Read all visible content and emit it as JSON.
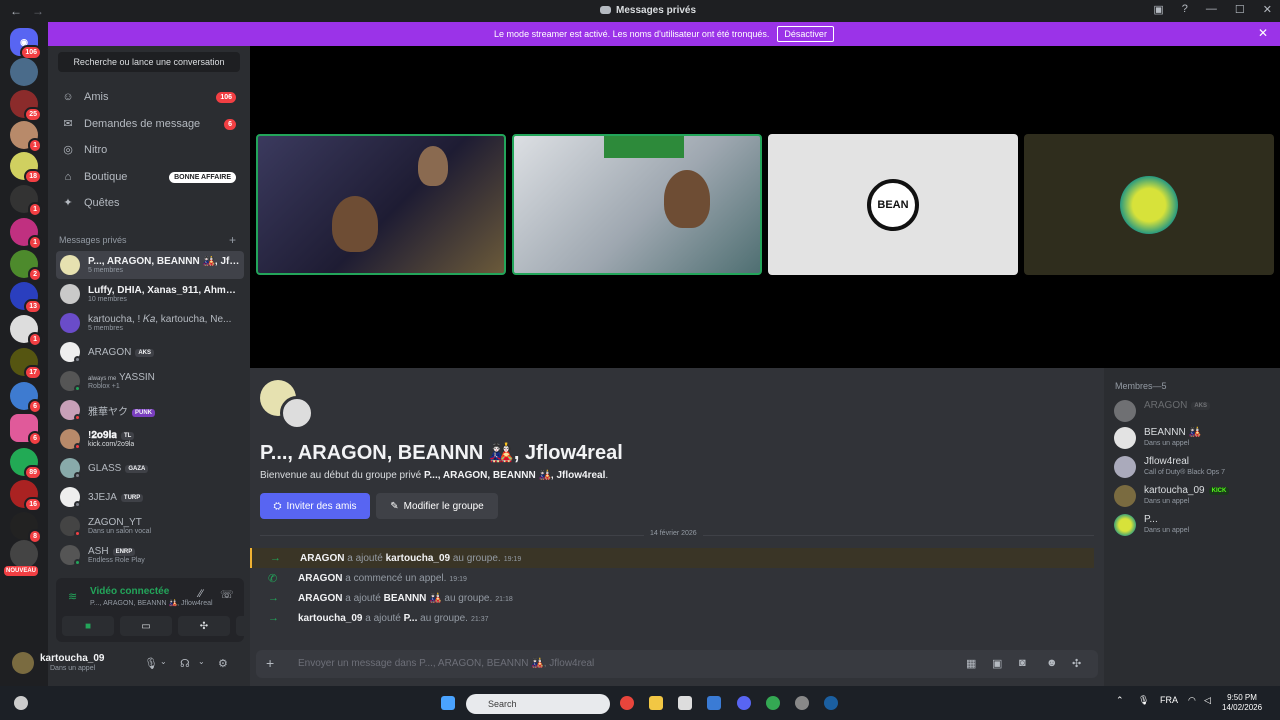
{
  "window": {
    "title": "Messages privés"
  },
  "banner": {
    "text": "Le mode streamer est activé. Les noms d'utilisateur ont été tronqués.",
    "button": "Désactiver"
  },
  "servers": {
    "badges": [
      "106",
      "25",
      "1",
      "18",
      "1",
      "1",
      "2",
      "13",
      "1",
      "17",
      "6",
      "6",
      "89",
      "16",
      "8"
    ],
    "nouveau": "NOUVEAU"
  },
  "sidebar": {
    "search": "Recherche ou lance une conversation",
    "nav": [
      {
        "label": "Amis",
        "count": "106"
      },
      {
        "label": "Demandes de message",
        "count": "6"
      },
      {
        "label": "Nitro"
      },
      {
        "label": "Boutique",
        "pill": "BONNE AFFAIRE"
      },
      {
        "label": "Quêtes"
      }
    ],
    "dm_header": "Messages privés",
    "dms": [
      {
        "name": "P..., ARAGON, BEANNN 🎎, Jfl...",
        "sub": "5 membres"
      },
      {
        "name": "Luffy, DHIA, Xanas_911, Ahmed...",
        "sub": "10 membres"
      },
      {
        "name": "kartoucha, ! 𝐾𝑎, kartoucha, Ne...",
        "sub": "5 membres"
      },
      {
        "name": "ARAGON",
        "tag": "AKS"
      },
      {
        "name": "YASSIN",
        "prefix": "always me",
        "sub": "Roblox +1"
      },
      {
        "name": "雅華ヤク",
        "tag": "PUNK"
      },
      {
        "name": "!𝟐𝐨𝟗𝐥𝐚",
        "tag": "TL",
        "sub": "kick.com/2o9la"
      },
      {
        "name": "GLASS",
        "tag": "GAZA"
      },
      {
        "name": "3JEJA",
        "tag": "TURP"
      },
      {
        "name": "ZAGON_YT",
        "sub": "Dans un salon vocal"
      },
      {
        "name": "ASH",
        "tag": "ENRP",
        "sub": "Endless Role Play"
      }
    ]
  },
  "voice": {
    "title": "Vidéo connectée",
    "sub": "P..., ARAGON, BEANNN 🎎, Jflow4real"
  },
  "user": {
    "name": "kartoucha_09",
    "status": "Dans un appel"
  },
  "tiles": {
    "t3_logo": "BEAN"
  },
  "chat": {
    "title": "P..., ARAGON, BEANNN 🎎, Jflow4real",
    "desc_prefix": "Bienvenue au début du groupe privé ",
    "desc_names": "P..., ARAGON, BEANNN 🎎, Jflow4real",
    "desc_suffix": ".",
    "invite": "Inviter des amis",
    "edit": "Modifier le groupe",
    "date": "14 février 2026",
    "messages": [
      {
        "actor": "ARAGON",
        "verb": "a ajouté",
        "target": "kartoucha_09",
        "tail": "au groupe.",
        "time": "19:19"
      },
      {
        "actor": "ARAGON",
        "verb": "a commencé un appel.",
        "target": "",
        "tail": "",
        "time": "19:19"
      },
      {
        "actor": "ARAGON",
        "verb": "a ajouté",
        "target": "BEANNN 🎎",
        "tail": "au groupe.",
        "time": "21:18"
      },
      {
        "actor": "kartoucha_09",
        "verb": "a ajouté",
        "target": "P...",
        "tail": "au groupe.",
        "time": "21:37"
      }
    ],
    "composer_placeholder": "Envoyer un message dans P..., ARAGON, BEANNN 🎎, Jflow4real"
  },
  "members": {
    "header": "Membres—5",
    "list": [
      {
        "name": "ARAGON",
        "tag": "AKS",
        "sub": ""
      },
      {
        "name": "BEANNN 🎎",
        "sub": "Dans un appel"
      },
      {
        "name": "Jflow4real",
        "sub": "Call of Duty® Black Ops 7"
      },
      {
        "name": "kartoucha_09",
        "tag": "KICK",
        "sub": "Dans un appel"
      },
      {
        "name": "P...",
        "sub": "Dans un appel"
      }
    ]
  },
  "taskbar": {
    "search": "Search",
    "lang": "FRA",
    "time": "9:50 PM",
    "date": "14/02/2026"
  }
}
